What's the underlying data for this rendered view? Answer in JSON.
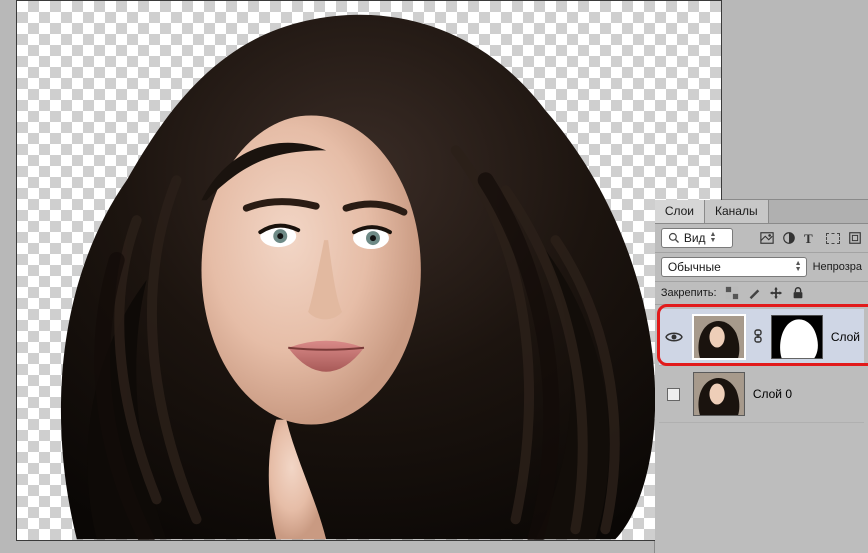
{
  "panel": {
    "tabs": {
      "layers": "Слои",
      "channels": "Каналы"
    },
    "filter": {
      "mode": "Вид"
    },
    "blend": {
      "mode": "Обычные",
      "opacity_label": "Непрозра"
    },
    "lock": {
      "label": "Закрепить:"
    },
    "layers": [
      {
        "name": "Слой",
        "visible": true,
        "has_mask": true,
        "selected": true
      },
      {
        "name": "Слой 0",
        "visible": false,
        "has_mask": false,
        "selected": false
      }
    ]
  },
  "icons": {
    "image": "image-icon",
    "adjust": "contrast-icon",
    "type": "T",
    "link": "⛓"
  }
}
